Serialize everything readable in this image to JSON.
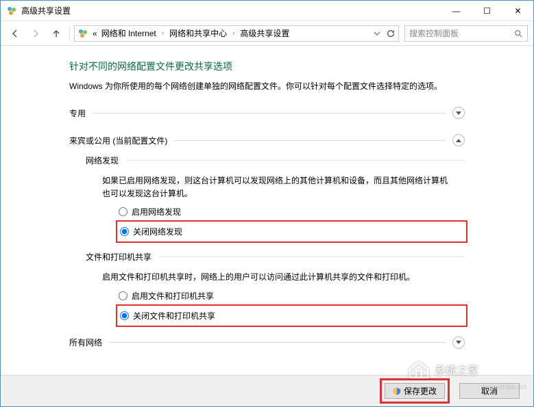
{
  "window": {
    "title": "高级共享设置"
  },
  "breadcrumb": {
    "prefix": "«",
    "items": [
      "网络和 Internet",
      "网络和共享中心",
      "高级共享设置"
    ]
  },
  "search": {
    "placeholder": "搜索控制面板"
  },
  "page": {
    "heading": "针对不同的网络配置文件更改共享选项",
    "desc": "Windows 为你所使用的每个网络创建单独的网络配置文件。你可以针对每个配置文件选择特定的选项。"
  },
  "sections": {
    "private": {
      "label": "专用",
      "expanded": false
    },
    "guest": {
      "label": "来宾或公用 (当前配置文件)",
      "expanded": true,
      "network_discovery": {
        "title": "网络发现",
        "desc": "如果已启用网络发现，则这台计算机可以发现网络上的其他计算机和设备，而且其他网络计算机也可以发现这台计算机。",
        "options": {
          "enable": "启用网络发现",
          "disable": "关闭网络发现"
        },
        "selected": "disable"
      },
      "file_printer": {
        "title": "文件和打印机共享",
        "desc": "启用文件和打印机共享时，网络上的用户可以访问通过此计算机共享的文件和打印机。",
        "options": {
          "enable": "启用文件和打印机共享",
          "disable": "关闭文件和打印机共享"
        },
        "selected": "disable"
      }
    },
    "all": {
      "label": "所有网络",
      "expanded": false
    }
  },
  "footer": {
    "save": "保存更改",
    "cancel": "取消"
  },
  "watermark": {
    "text": "系统之家",
    "url": "tongszhijia.net"
  }
}
